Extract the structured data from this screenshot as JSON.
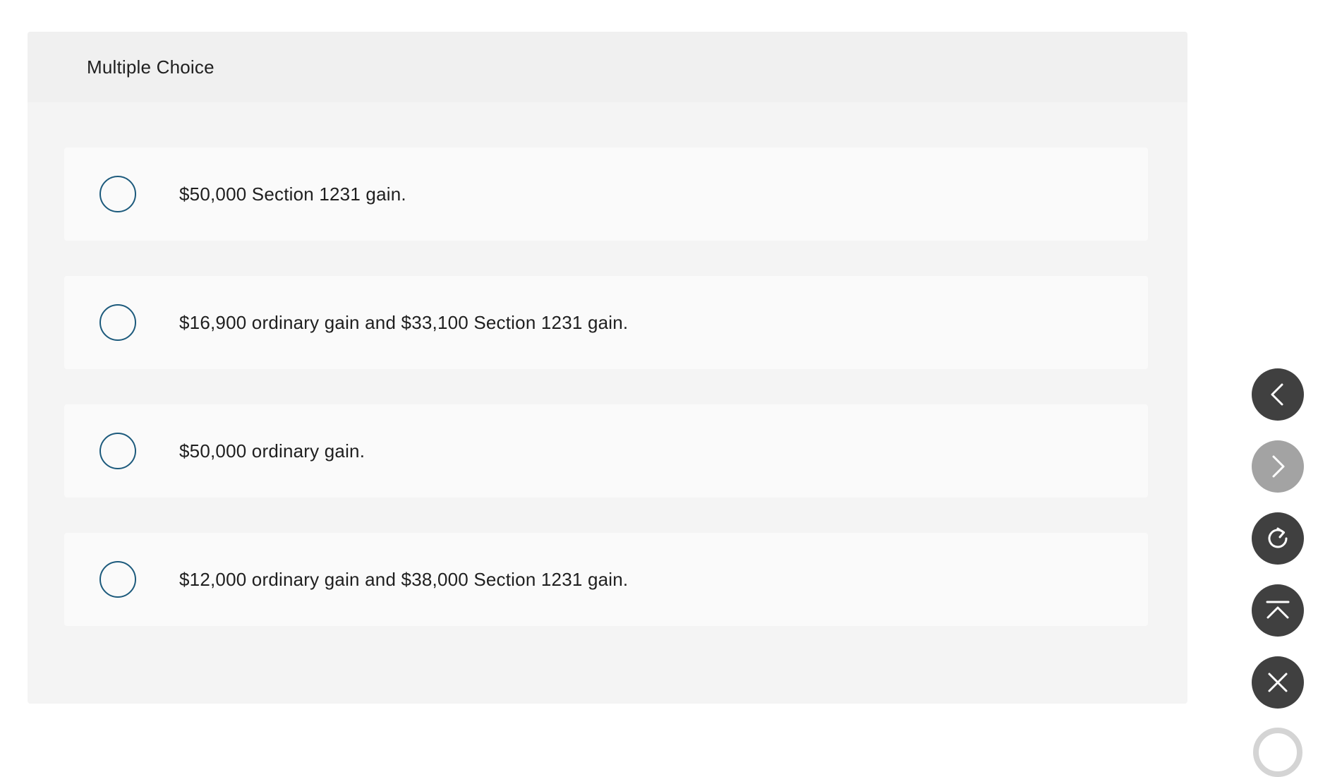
{
  "header": {
    "title": "Multiple Choice"
  },
  "choices": [
    {
      "label": "$50,000 Section 1231 gain."
    },
    {
      "label": "$16,900 ordinary gain and $33,100 Section 1231 gain."
    },
    {
      "label": "$50,000 ordinary gain."
    },
    {
      "label": "$12,000 ordinary gain and $38,000 Section 1231 gain."
    }
  ],
  "nav": {
    "prev": {
      "icon": "chevron-left-icon"
    },
    "next": {
      "icon": "chevron-right-icon",
      "state": "disabled"
    },
    "reset": {
      "icon": "refresh-icon"
    },
    "top": {
      "icon": "scroll-top-icon"
    },
    "close": {
      "icon": "close-icon"
    }
  },
  "colors": {
    "radio_border": "#1c5a7c",
    "nav_active": "#404040",
    "nav_disabled": "#a3a3a3",
    "card_background": "#f4f4f4"
  }
}
